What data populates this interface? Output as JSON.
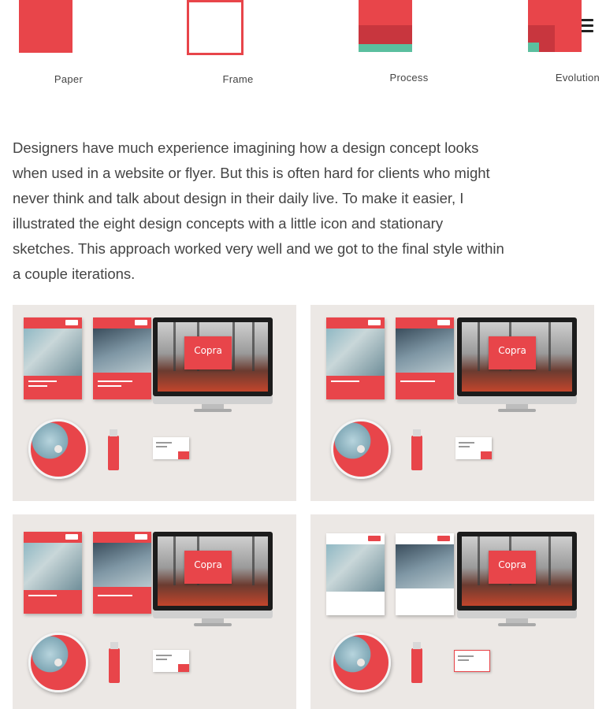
{
  "header": {
    "menu_icon": "hamburger-menu-icon"
  },
  "concepts": [
    {
      "label": "Paper"
    },
    {
      "label": "Frame"
    },
    {
      "label": "Process"
    },
    {
      "label": "Evolution"
    }
  ],
  "colors": {
    "brand_red": "#e8454a",
    "dark_red": "#c8363e",
    "teal": "#5bbf9f",
    "tile_bg": "#ece8e5"
  },
  "intro": {
    "text": "Designers have much experience imagining how a design concept looks when used in a website or flyer. But this is often hard for clients who might never think and talk about design in their daily live. To make it easier, I illustrated the eight design concepts with a little icon and stationary sketches. This approach worked very well and we got to the final style within a couple iterations."
  },
  "mockups": [
    {
      "brand": "Copra"
    },
    {
      "brand": "Copra"
    },
    {
      "brand": "Copra"
    },
    {
      "brand": "Copra"
    }
  ]
}
